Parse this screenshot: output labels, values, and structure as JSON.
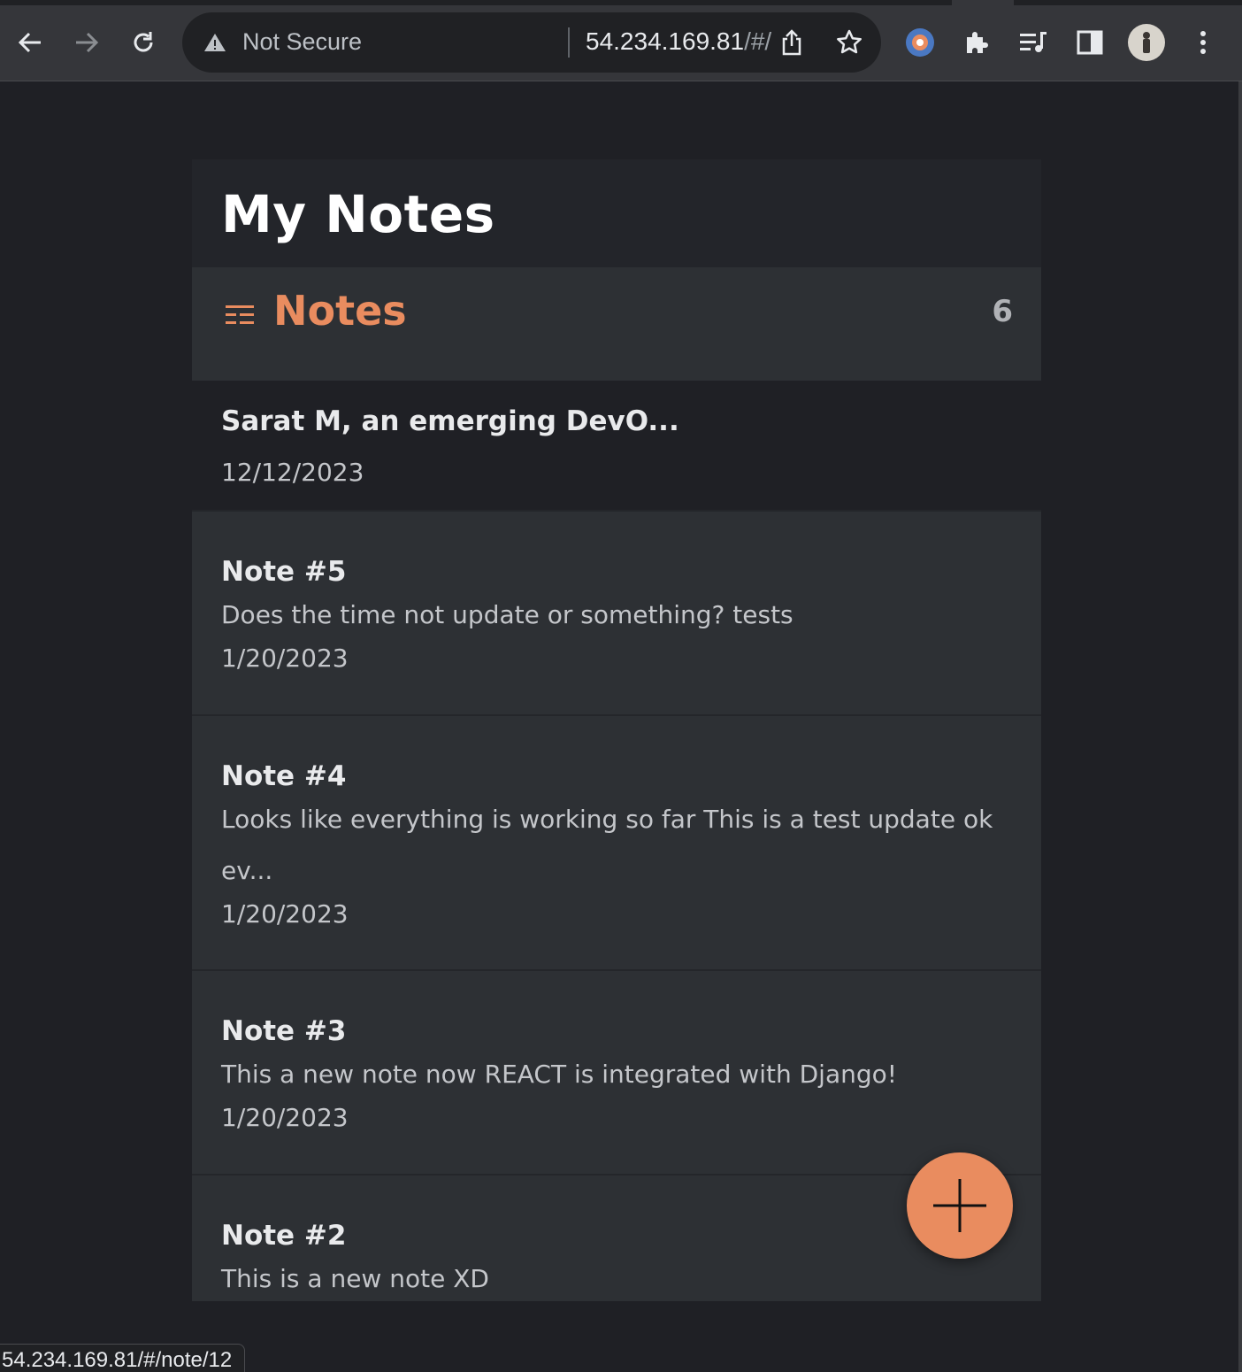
{
  "browser": {
    "security_label": "Not Secure",
    "url_host": "54.234.169.81",
    "url_path": "/#/",
    "status_url": "54.234.169.81/#/note/12"
  },
  "app": {
    "title": "My Notes",
    "notes_header": "Notes",
    "notes_count": "6",
    "accent_color": "#e98c5f"
  },
  "notes": [
    {
      "title": "Sarat M, an emerging DevO...",
      "body": "",
      "date": "12/12/2023"
    },
    {
      "title": "Note #5",
      "body": "Does the time not update or something? tests",
      "date": "1/20/2023"
    },
    {
      "title": "Note #4",
      "body": "Looks like everything is working so far This is a test update ok ev...",
      "date": "1/20/2023"
    },
    {
      "title": "Note #3",
      "body": "This a new note now REACT is integrated with Django!",
      "date": "1/20/2023"
    },
    {
      "title": "Note #2",
      "body": "This is a new note XD",
      "date": ""
    }
  ],
  "icons": {
    "back": "arrow-left-icon",
    "forward": "arrow-right-icon",
    "reload": "reload-icon",
    "warning": "warning-icon",
    "share": "share-icon",
    "bookmark": "star-icon",
    "extension": "extension-icon",
    "extensions": "puzzle-icon",
    "media": "media-control-icon",
    "sidepanel": "side-panel-icon",
    "profile": "avatar",
    "menu": "kebab-menu-icon",
    "notes": "list-icon",
    "add": "plus-icon"
  }
}
